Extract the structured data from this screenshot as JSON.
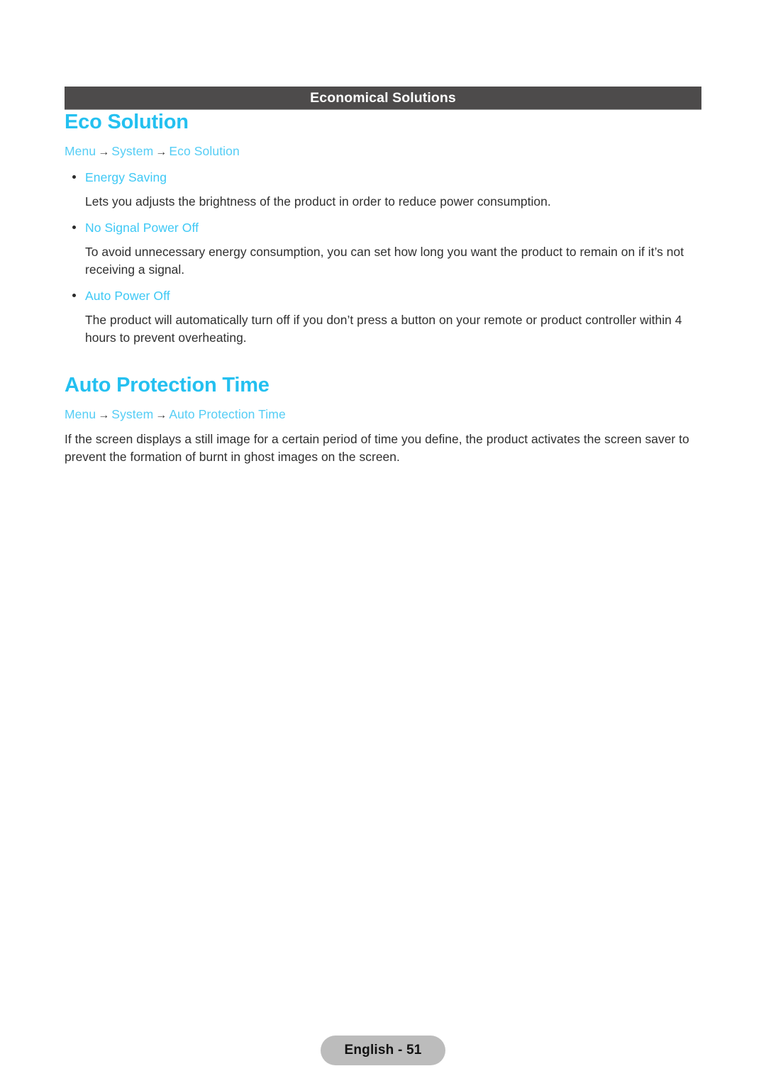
{
  "banner": {
    "title": "Economical Solutions"
  },
  "sections": [
    {
      "heading": "Eco Solution",
      "breadcrumb": {
        "root": "Menu",
        "arrow": "→",
        "middle": "System",
        "leaf": "Eco Solution"
      },
      "options": [
        {
          "label": "Energy Saving",
          "description": "Lets you adjusts the brightness of the product in order to reduce power consumption."
        },
        {
          "label": "No Signal Power Off",
          "description": "To avoid unnecessary energy consumption, you can set how long you want the product to remain on if it’s not receiving a signal."
        },
        {
          "label": "Auto Power Off",
          "description": "The product will automatically turn off if you don’t press a button on your remote or product controller within 4 hours to prevent overheating."
        }
      ]
    },
    {
      "heading": "Auto Protection Time",
      "breadcrumb": {
        "root": "Menu",
        "arrow": "→",
        "middle": "System",
        "leaf": "Auto Protection Time"
      },
      "body": "If the screen displays a still image for a certain period of time you define, the product activates the screen saver to prevent the formation of burnt in ghost images on the screen."
    }
  ],
  "footer": {
    "page_label": "English - 51"
  },
  "colors": {
    "banner_background": "#4d4b4b",
    "heading_accent": "#24c0f0",
    "breadcrumb_accent": "#54cdf5",
    "option_accent": "#3dc8f5",
    "body_text": "#2f2f2f",
    "footer_badge": "#bcbcbc"
  }
}
